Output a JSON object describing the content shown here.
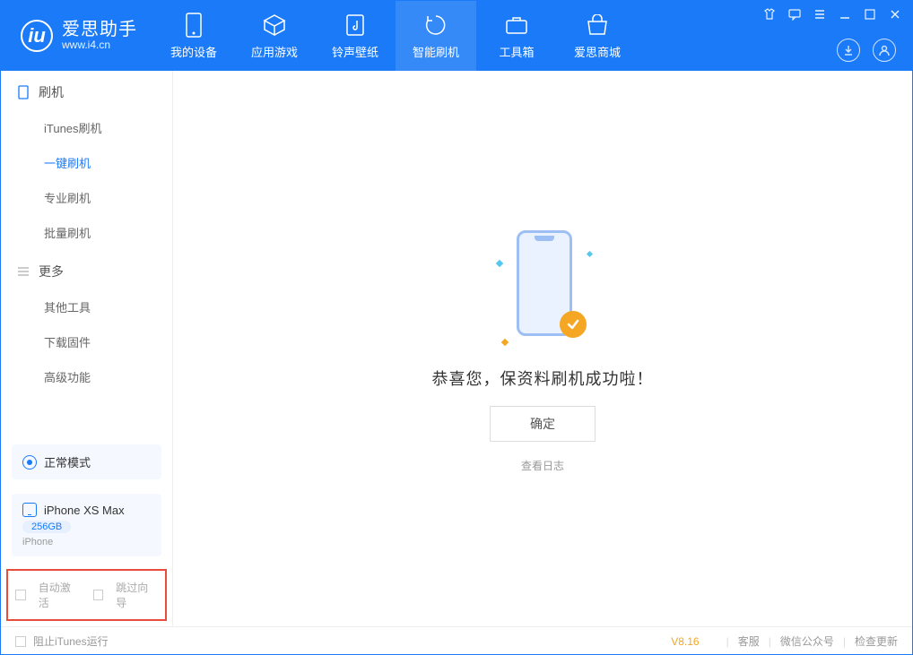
{
  "app": {
    "name_cn": "爱思助手",
    "name_en": "www.i4.cn",
    "logo_glyph": "iu"
  },
  "nav": {
    "tabs": [
      {
        "label": "我的设备"
      },
      {
        "label": "应用游戏"
      },
      {
        "label": "铃声壁纸"
      },
      {
        "label": "智能刷机"
      },
      {
        "label": "工具箱"
      },
      {
        "label": "爱思商城"
      }
    ],
    "active_index": 3
  },
  "sidebar": {
    "section1_title": "刷机",
    "section1_items": [
      {
        "label": "iTunes刷机"
      },
      {
        "label": "一键刷机"
      },
      {
        "label": "专业刷机"
      },
      {
        "label": "批量刷机"
      }
    ],
    "section1_active_index": 1,
    "section2_title": "更多",
    "section2_items": [
      {
        "label": "其他工具"
      },
      {
        "label": "下载固件"
      },
      {
        "label": "高级功能"
      }
    ],
    "mode_label": "正常模式",
    "device": {
      "name": "iPhone XS Max",
      "capacity": "256GB",
      "type": "iPhone"
    },
    "bottom_checks": {
      "auto_activate": "自动激活",
      "skip_guide": "跳过向导"
    }
  },
  "main": {
    "success_text": "恭喜您，保资料刷机成功啦！",
    "ok_button": "确定",
    "view_log": "查看日志"
  },
  "statusbar": {
    "block_itunes": "阻止iTunes运行",
    "version": "V8.16",
    "support": "客服",
    "wechat": "微信公众号",
    "check_update": "检查更新"
  }
}
